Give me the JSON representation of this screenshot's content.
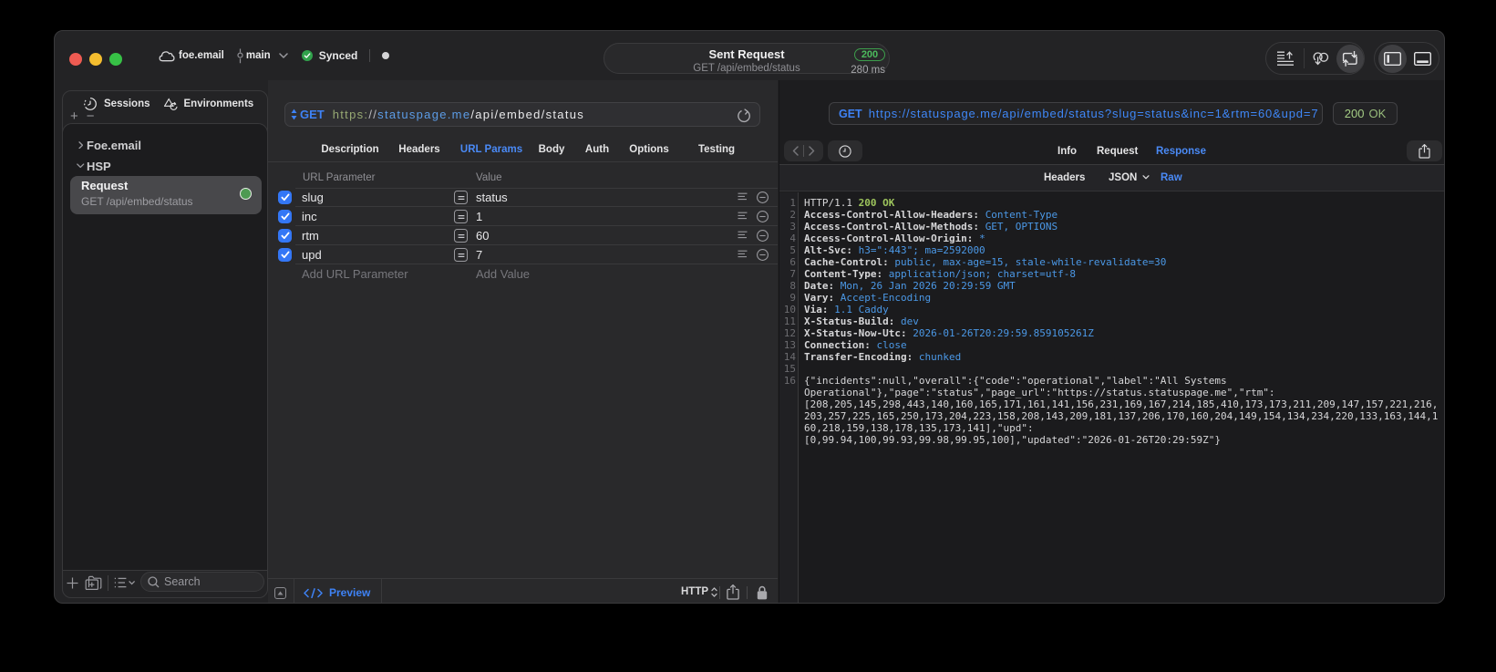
{
  "titlebar": {
    "project_name": "foe.email",
    "branch_name": "main",
    "sync_status": "Synced",
    "center": {
      "title": "Sent Request",
      "subtitle": "GET /api/embed/status",
      "status_code": "200",
      "duration": "280 ms"
    },
    "toolbar_icons": [
      "publish-list",
      "pull-linked",
      "sync-square",
      "toggle-left-sidebar",
      "toggle-bottom-panel"
    ]
  },
  "sidebar": {
    "tabs": [
      {
        "label": "Sessions",
        "icon": "history-clock"
      },
      {
        "label": "Environments",
        "icon": "shapes"
      }
    ],
    "tree": [
      {
        "label": "Foe.email",
        "expanded": false
      },
      {
        "label": "HSP",
        "expanded": true
      }
    ],
    "selected_request": {
      "title": "Request",
      "subtitle": "GET /api/embed/status",
      "status_dot_color": "#4e9a52"
    },
    "search": {
      "placeholder": "Search"
    }
  },
  "request_panel": {
    "url_field": {
      "method": "GET",
      "scheme": "https:",
      "separator": "//",
      "host": "statuspage.me",
      "path": "/api/embed/status"
    },
    "tabs": [
      "Description",
      "Headers",
      "URL Params",
      "Body",
      "Auth",
      "Options",
      "Testing"
    ],
    "active_tab": "URL Params",
    "param_table": {
      "columns": [
        "URL Parameter",
        "Value"
      ],
      "rows": [
        {
          "key": "slug",
          "value": "status",
          "enabled": true
        },
        {
          "key": "inc",
          "value": "1",
          "enabled": true
        },
        {
          "key": "rtm",
          "value": "60",
          "enabled": true
        },
        {
          "key": "upd",
          "value": "7",
          "enabled": true
        }
      ],
      "add_key_placeholder": "Add URL Parameter",
      "add_value_placeholder": "Add Value"
    },
    "footer": {
      "preview_label": "Preview",
      "protocol_label": "HTTP"
    }
  },
  "response_panel": {
    "request_line": {
      "method": "GET",
      "url": "https://statuspage.me/api/embed/status?slug=status&inc=1&rtm=60&upd=7"
    },
    "status_badge": {
      "code": "200",
      "text": "OK"
    },
    "tabs": [
      "Info",
      "Request",
      "Response"
    ],
    "active_tab": "Response",
    "subtabs": [
      "Headers",
      "JSON",
      "Raw"
    ],
    "active_subtab": "Raw",
    "raw": {
      "status_line": {
        "version": "HTTP/1.1",
        "status": "200 OK"
      },
      "headers": [
        {
          "name": "Access-Control-Allow-Headers",
          "value": "Content-Type"
        },
        {
          "name": "Access-Control-Allow-Methods",
          "value": "GET, OPTIONS"
        },
        {
          "name": "Access-Control-Allow-Origin",
          "value": "*"
        },
        {
          "name": "Alt-Svc",
          "value": "h3=\":443\"; ma=2592000"
        },
        {
          "name": "Cache-Control",
          "value": "public, max-age=15, stale-while-revalidate=30"
        },
        {
          "name": "Content-Type",
          "value": "application/json; charset=utf-8"
        },
        {
          "name": "Date",
          "value": "Mon, 26 Jan 2026 20:29:59 GMT"
        },
        {
          "name": "Vary",
          "value": "Accept-Encoding"
        },
        {
          "name": "Via",
          "value": "1.1 Caddy"
        },
        {
          "name": "X-Status-Build",
          "value": "dev"
        },
        {
          "name": "X-Status-Now-Utc",
          "value": "2026-01-26T20:29:59.859105261Z"
        },
        {
          "name": "Connection",
          "value": "close"
        },
        {
          "name": "Transfer-Encoding",
          "value": "chunked"
        }
      ],
      "body_lines": [
        "{\"incidents\":null,\"overall\":{\"code\":\"operational\",\"label\":\"All Systems",
        "Operational\"},\"page\":\"status\",\"page_url\":\"https://status.statuspage.me\",\"rtm\":",
        "[208,205,145,298,443,140,160,165,171,161,141,156,231,169,167,214,185,410,173,173,211,209,147,157,221,216,",
        "203,257,225,165,250,173,204,223,158,208,143,209,181,137,206,170,160,204,149,154,134,234,220,133,163,144,1",
        "60,218,159,138,178,135,173,141],\"upd\":",
        "[0,99.94,100,99.93,99.98,99.95,100],\"updated\":\"2026-01-26T20:29:59Z\"}"
      ]
    }
  },
  "colors": {
    "accent_blue": "#4a8af6",
    "value_blue": "#4b98e6",
    "status_green": "#9dc45c",
    "checkbox_blue": "#3477f6",
    "dot_green": "#4e9a52"
  }
}
